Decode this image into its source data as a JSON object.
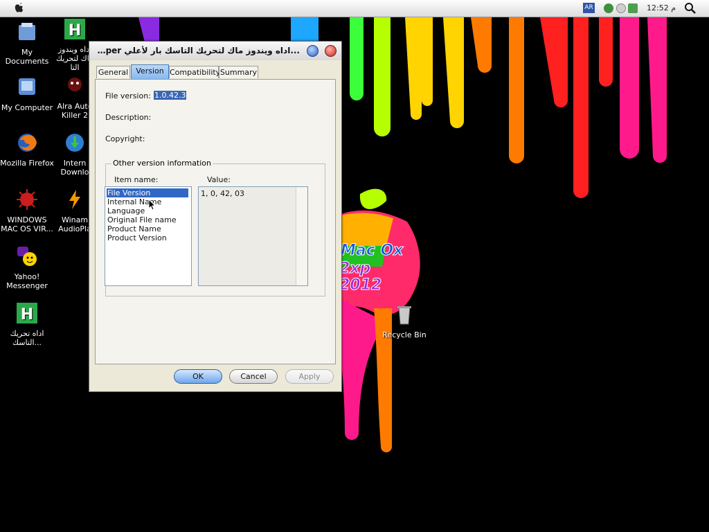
{
  "menubar": {
    "language_indicator": "AR",
    "clock": "12:52 م",
    "icons": [
      "apple-icon",
      "network-icon",
      "volume-icon",
      "safely-remove-icon",
      "search-icon"
    ]
  },
  "wallpaper": {
    "text_line1": "Mac Ox",
    "text_line2": "2xp",
    "text_line3": "2012",
    "colors": [
      "#ff1a8c",
      "#ff2020",
      "#ff7a00",
      "#ffd400",
      "#b6ff00",
      "#3cff3c",
      "#1ea7ff",
      "#8a2be2"
    ]
  },
  "desktop": {
    "icons": [
      {
        "label": "My Documents",
        "icon": "folder-icon"
      },
      {
        "label": "My Computer",
        "icon": "computer-icon"
      },
      {
        "label": "Mozilla Firefox",
        "icon": "firefox-icon"
      },
      {
        "label": "WINDOWS MAC OS VIR...",
        "icon": "virus-icon"
      },
      {
        "label": "Yahoo! Messenger",
        "icon": "yahoo-icon"
      },
      {
        "label": "اداه تحريك التاسك...",
        "icon": "h-app-icon"
      },
      {
        "label": "اداه ويندوز ماك لتحريك التا",
        "icon": "h-app-icon"
      },
      {
        "label": "Alra Auto Killer 2",
        "icon": "killer-icon"
      },
      {
        "label": "Intern Downlo",
        "icon": "idm-icon"
      },
      {
        "label": "Winam AudioPla",
        "icon": "winamp-icon"
      },
      {
        "label": "Recycle Bin",
        "icon": "recycle-bin-icon"
      }
    ]
  },
  "dialog": {
    "title": "...اداه ويندوز ماك لتحريك التاسك بار لأعلي Proper",
    "tabs": [
      {
        "label": "General"
      },
      {
        "label": "Version"
      },
      {
        "label": "Compatibility"
      },
      {
        "label": "Summary"
      }
    ],
    "file_version_label": "File version:",
    "file_version_value": "1.0.42.3",
    "description_label": "Description:",
    "copyright_label": "Copyright:",
    "group_title": "Other version information",
    "item_name_label": "Item name:",
    "value_label": "Value:",
    "items": [
      {
        "label": "File Version"
      },
      {
        "label": "Internal Name"
      },
      {
        "label": "Language"
      },
      {
        "label": "Original File name"
      },
      {
        "label": "Product Name"
      },
      {
        "label": "Product Version"
      }
    ],
    "selected_value": "1, 0, 42, 03",
    "ok_label": "OK",
    "cancel_label": "Cancel",
    "apply_label": "Apply"
  }
}
